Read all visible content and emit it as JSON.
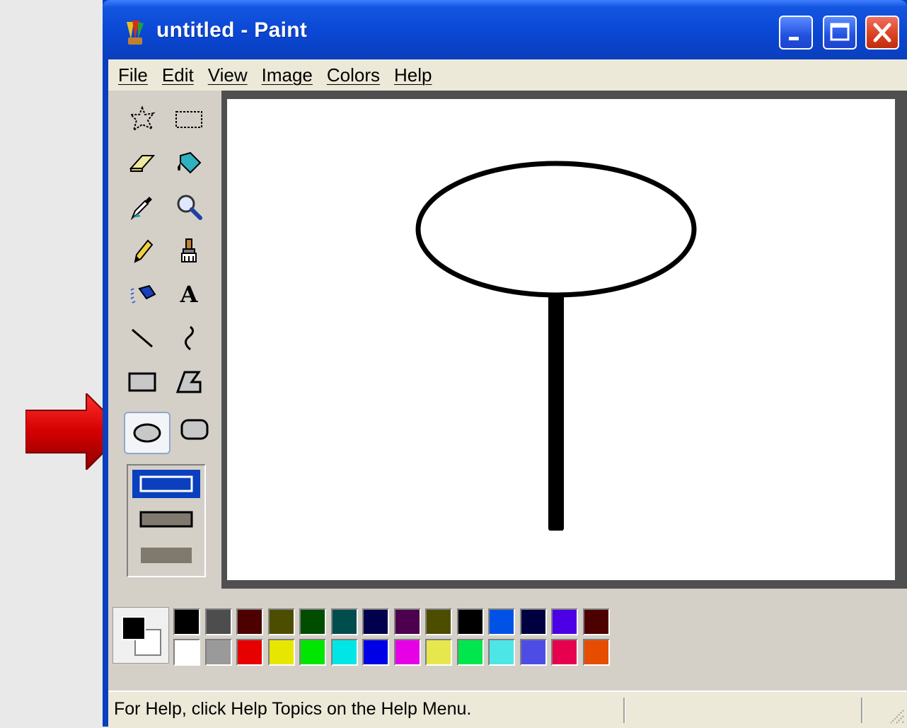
{
  "window": {
    "title": "untitled - Paint",
    "icon": "paint-app-icon",
    "controls": [
      "minimize-icon",
      "maximize-icon",
      "close-icon"
    ]
  },
  "menu": [
    "File",
    "Edit",
    "View",
    "Image",
    "Colors",
    "Help"
  ],
  "toolbox": {
    "tools": [
      {
        "name": "free-form-select"
      },
      {
        "name": "rectangle-select"
      },
      {
        "name": "eraser"
      },
      {
        "name": "fill-with-color"
      },
      {
        "name": "pick-color"
      },
      {
        "name": "magnifier"
      },
      {
        "name": "pencil"
      },
      {
        "name": "brush"
      },
      {
        "name": "airbrush"
      },
      {
        "name": "text"
      },
      {
        "name": "line"
      },
      {
        "name": "curve"
      },
      {
        "name": "rectangle"
      },
      {
        "name": "polygon"
      },
      {
        "name": "ellipse",
        "selected": true
      },
      {
        "name": "rounded-rectangle"
      }
    ],
    "text_tool_glyph": "A",
    "fill_style_options": [
      "outline",
      "outline-and-fill",
      "fill-only"
    ],
    "selected_fill_style": "outline"
  },
  "palette": {
    "foreground": "#000000",
    "background": "#ffffff",
    "top_row": [
      "#000000",
      "#4d4d4d",
      "#4d0000",
      "#4d4d00",
      "#004d00",
      "#004d4d",
      "#00004d",
      "#4d004d",
      "#4d4d00",
      "#000000",
      "#0052e6",
      "#000040",
      "#4d00e6",
      "#4d0000"
    ],
    "bottom_row": [
      "#ffffff",
      "#9a9a9a",
      "#e60000",
      "#e6e600",
      "#00e600",
      "#00e6e6",
      "#0000e6",
      "#e600e6",
      "#e6e64d",
      "#00e64d",
      "#4de6e6",
      "#4d4de6",
      "#e6004d",
      "#e64d00"
    ]
  },
  "status": {
    "help_text": "For Help, click Help Topics on the Help Menu."
  },
  "colors": {
    "title_blue": "#0a3fbd",
    "menu_bg": "#ece9d8",
    "arrow_red": "#d40000"
  }
}
